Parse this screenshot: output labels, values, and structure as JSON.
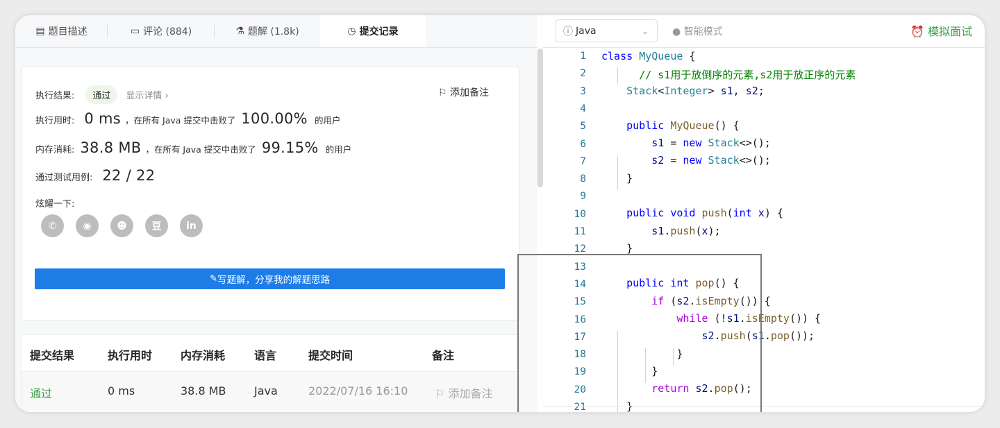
{
  "tabs": [
    {
      "icon": "▤",
      "label": "题目描述"
    },
    {
      "icon": "▭",
      "label": "评论 (884)"
    },
    {
      "icon": "⚗",
      "label": "题解 (1.8k)"
    },
    {
      "icon": "◷",
      "label": "提交记录"
    }
  ],
  "result": {
    "exec_label": "执行结果:",
    "status": "通过",
    "detail_link": "显示详情 ›",
    "add_note": "添加备注",
    "time_label": "执行用时:",
    "time_value": "0 ms",
    "time_text": "，在所有 Java 提交中击败了",
    "time_percent": "100.00%",
    "time_suffix": "的用户",
    "mem_label": "内存消耗:",
    "mem_value": "38.8 MB",
    "mem_text": "，在所有 Java 提交中击败了",
    "mem_percent": "99.15%",
    "mem_suffix": "的用户",
    "tests_label": "通过测试用例:",
    "tests_value": "22 / 22",
    "share_label": "炫耀一下:",
    "share_button": "写题解，分享我的解题思路",
    "social_icons": [
      "wechat-icon",
      "weibo-icon",
      "qq-icon",
      "douban-icon",
      "linkedin-icon"
    ]
  },
  "table": {
    "headers": [
      "提交结果",
      "执行用时",
      "内存消耗",
      "语言",
      "提交时间",
      "备注"
    ],
    "rows": [
      {
        "result": "通过",
        "time": "0 ms",
        "memory": "38.8 MB",
        "language": "Java",
        "submitted": "2022/07/16 16:10",
        "note": "添加备注"
      }
    ]
  },
  "editor": {
    "language": "Java",
    "mode": "智能模式",
    "mock_interview": "模拟面试",
    "line_numbers": [
      "1",
      "2",
      "3",
      "4",
      "5",
      "6",
      "7",
      "8",
      "9",
      "10",
      "11",
      "12",
      "13",
      "14",
      "15",
      "16",
      "17",
      "18",
      "19",
      "20",
      "21"
    ]
  },
  "colors": {
    "accent": "#1e7ce6",
    "pass_green": "#3aa04a",
    "keyword": "#0000ff",
    "type": "#267f99",
    "comment": "#008000"
  }
}
